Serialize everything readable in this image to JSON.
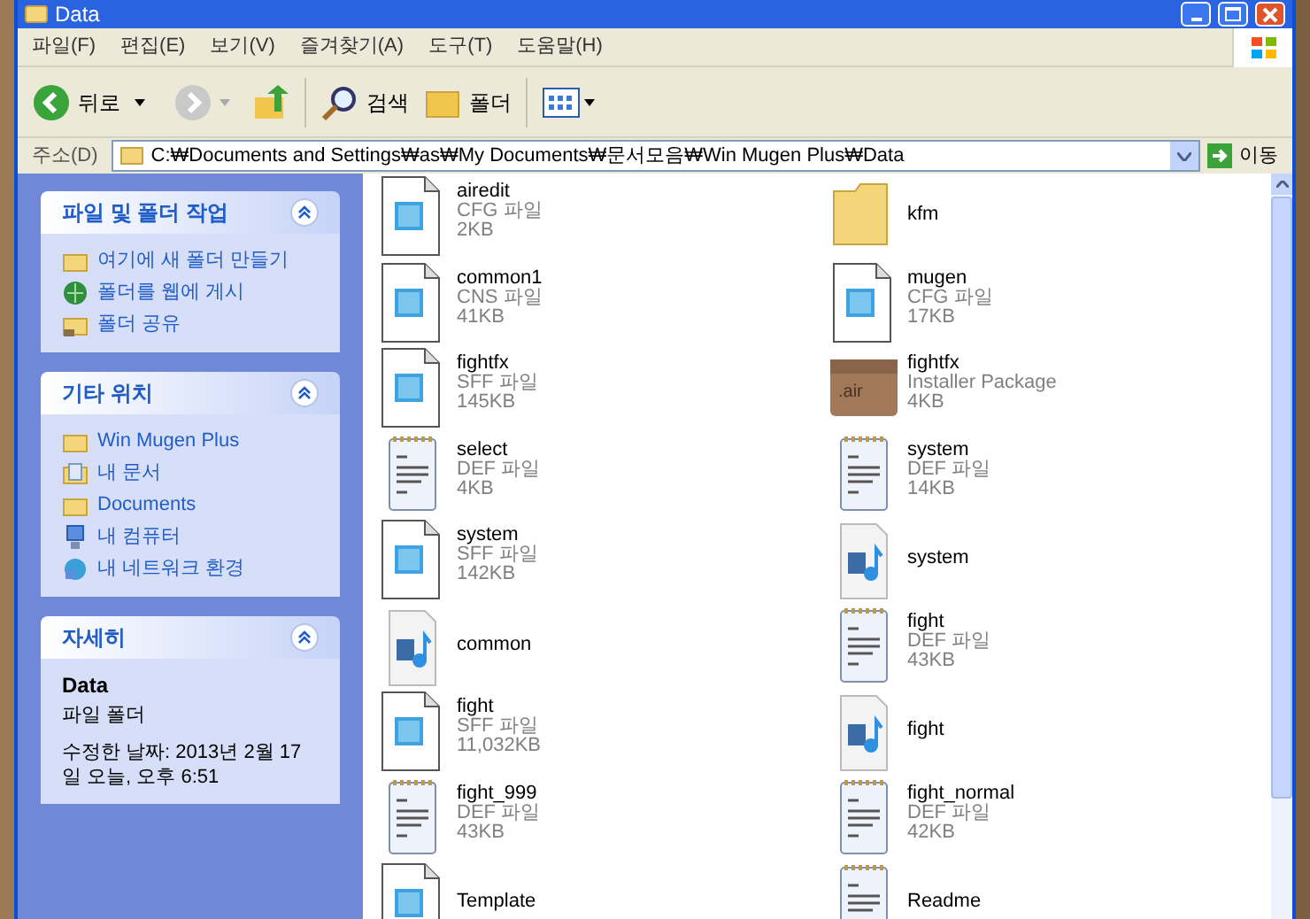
{
  "window": {
    "title": "Data"
  },
  "menu": [
    "파일(F)",
    "편집(E)",
    "보기(V)",
    "즐겨찾기(A)",
    "도구(T)",
    "도움말(H)"
  ],
  "toolbar": {
    "back": "뒤로",
    "search": "검색",
    "folders": "폴더"
  },
  "address": {
    "label": "주소(D)",
    "value": "C:₩Documents and Settings₩as₩My Documents₩문서모음₩Win Mugen Plus₩Data",
    "go": "이동"
  },
  "panels": [
    {
      "title": "파일 및 폴더 작업",
      "items": [
        {
          "kind": "newfolder",
          "label": "여기에 새 폴더 만들기"
        },
        {
          "kind": "web",
          "label": "폴더를 웹에 게시"
        },
        {
          "kind": "share",
          "label": "폴더 공유"
        }
      ]
    },
    {
      "title": "기타 위치",
      "items": [
        {
          "kind": "folder",
          "label": "Win Mugen Plus"
        },
        {
          "kind": "docs",
          "label": "내 문서"
        },
        {
          "kind": "folder",
          "label": "Documents"
        },
        {
          "kind": "computer",
          "label": "내 컴퓨터"
        },
        {
          "kind": "network",
          "label": "내 네트워크 환경"
        }
      ]
    }
  ],
  "details": {
    "title": "자세히",
    "name": "Data",
    "type": "파일 폴더",
    "modified": "수정한 날짜: 2013년 2월 17일 오늘, 오후 6:51"
  },
  "files": [
    {
      "kind": "app",
      "name": "airedit",
      "type": "CFG 파일",
      "size": "2KB"
    },
    {
      "kind": "folder",
      "name": "kfm"
    },
    {
      "kind": "app",
      "name": "common1",
      "type": "CNS 파일",
      "size": "41KB"
    },
    {
      "kind": "app",
      "name": "mugen",
      "type": "CFG 파일",
      "size": "17KB"
    },
    {
      "kind": "app",
      "name": "fightfx",
      "type": "SFF 파일",
      "size": "145KB"
    },
    {
      "kind": "package",
      "icon_label": ".air",
      "name": "fightfx",
      "type": "Installer Package",
      "size": "4KB"
    },
    {
      "kind": "notepad",
      "name": "select",
      "type": "DEF 파일",
      "size": "4KB"
    },
    {
      "kind": "notepad",
      "name": "system",
      "type": "DEF 파일",
      "size": "14KB"
    },
    {
      "kind": "app",
      "name": "system",
      "type": "SFF 파일",
      "size": "142KB"
    },
    {
      "kind": "media",
      "name": "system"
    },
    {
      "kind": "media",
      "name": "common"
    },
    {
      "kind": "notepad",
      "name": "fight",
      "type": "DEF 파일",
      "size": "43KB"
    },
    {
      "kind": "app",
      "name": "fight",
      "type": "SFF 파일",
      "size": "11,032KB"
    },
    {
      "kind": "media",
      "name": "fight"
    },
    {
      "kind": "notepad",
      "name": "fight_999",
      "type": "DEF 파일",
      "size": "43KB"
    },
    {
      "kind": "notepad",
      "name": "fight_normal",
      "type": "DEF 파일",
      "size": "42KB"
    },
    {
      "kind": "app",
      "name": "Template"
    },
    {
      "kind": "notepad",
      "name": "Readme"
    }
  ]
}
